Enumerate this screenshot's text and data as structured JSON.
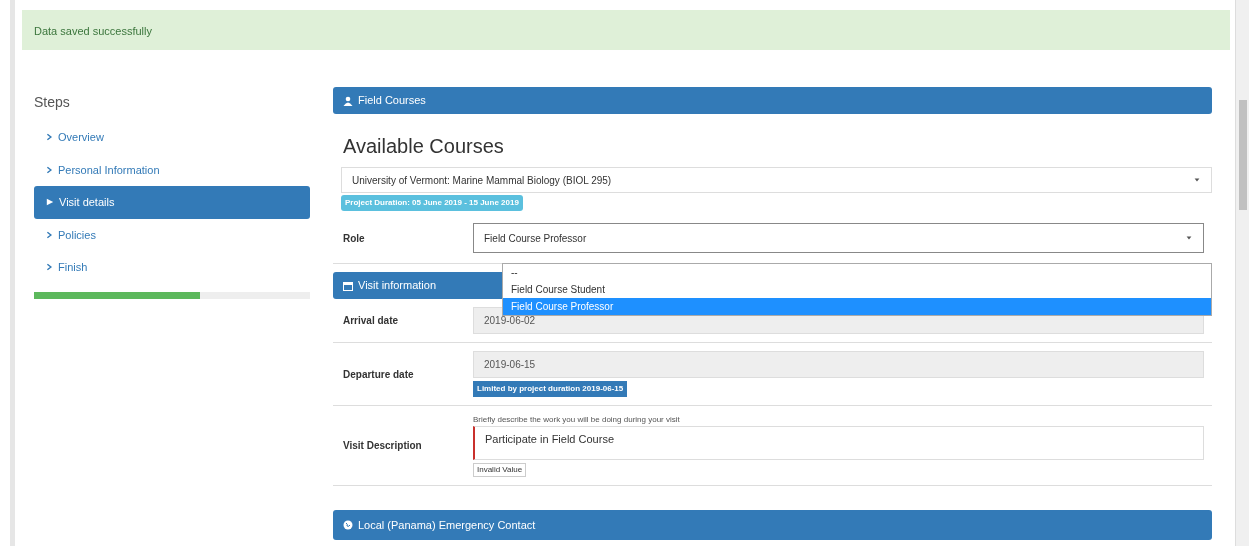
{
  "alert": {
    "text": "Data saved successfully"
  },
  "steps": {
    "title": "Steps",
    "items": [
      {
        "label": "Overview",
        "selected": false
      },
      {
        "label": "Personal Information",
        "selected": false
      },
      {
        "label": "Visit details",
        "selected": true
      },
      {
        "label": "Policies",
        "selected": false
      },
      {
        "label": "Finish",
        "selected": false
      }
    ],
    "progress": {
      "level": 0.6
    }
  },
  "field_courses": {
    "header": "Field Courses",
    "heading": "Available Courses",
    "course": "University of Vermont: Marine Mammal Biology (BIOL 295)",
    "duration_badge": "Project Duration: 05 June 2019 - 15 June 2019",
    "role": {
      "label": "Role",
      "value": "Field Course Professor",
      "options": [
        {
          "label": "--",
          "selected": false
        },
        {
          "label": "Field Course Student",
          "selected": false
        },
        {
          "label": "Field Course Professor",
          "selected": true
        }
      ]
    }
  },
  "visit_information": {
    "header": "Visit information",
    "arrival": {
      "label": "Arrival date",
      "value": "2019-06-02"
    },
    "departure": {
      "label": "Departure date",
      "value": "2019-06-15",
      "badge": "Limited by project duration 2019-06-15"
    },
    "description": {
      "label": "Visit Description",
      "help": "Briefly describe the work you will be doing during your visit",
      "value": "Participate in Field Course",
      "tooltip": "Invalid Value"
    }
  },
  "emergency_contact": {
    "header": "Local (Panama) Emergency Contact"
  }
}
